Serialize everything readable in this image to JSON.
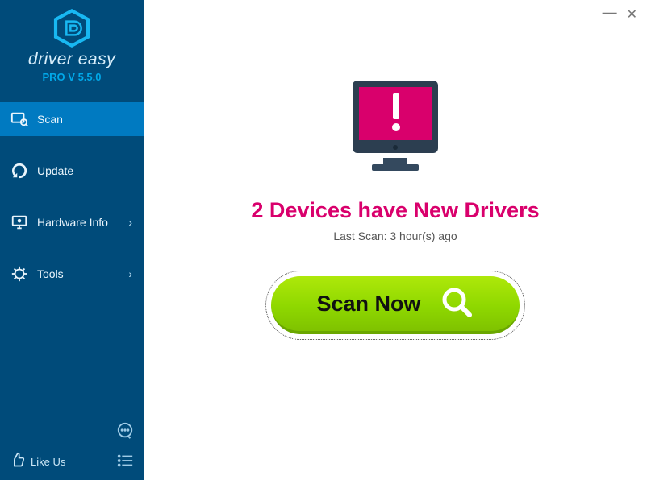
{
  "brand": {
    "name": "driver easy",
    "version": "PRO V 5.5.0"
  },
  "sidebar": {
    "items": [
      {
        "label": "Scan",
        "active": true,
        "expandable": false
      },
      {
        "label": "Update",
        "active": false,
        "expandable": false
      },
      {
        "label": "Hardware Info",
        "active": false,
        "expandable": true
      },
      {
        "label": "Tools",
        "active": false,
        "expandable": true
      }
    ],
    "like_label": "Like Us"
  },
  "main": {
    "headline": "2 Devices have New Drivers",
    "subline": "Last Scan: 3 hour(s) ago",
    "scan_button": "Scan Now"
  },
  "window": {
    "minimize": "—",
    "close": "✕"
  },
  "colors": {
    "sidebar_bg": "#004b7a",
    "sidebar_active": "#007ac1",
    "brand_version": "#00a8e8",
    "headline": "#d9006c",
    "scan_button": "#8fd800"
  }
}
